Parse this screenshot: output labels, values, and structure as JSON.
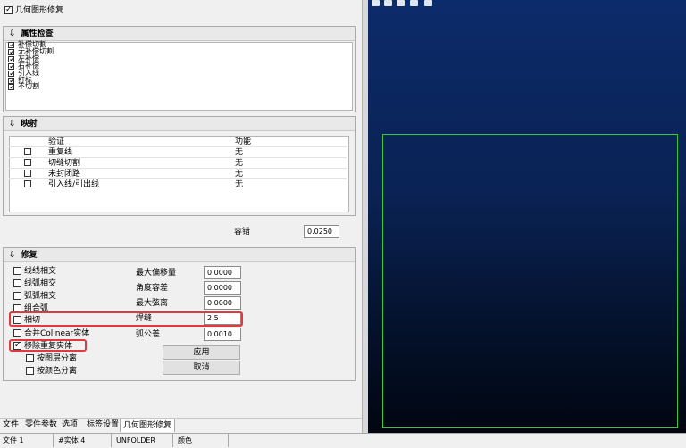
{
  "top_checkbox": {
    "label": "几何图形修复",
    "checked": true
  },
  "attribute_check": {
    "title": "属性检查",
    "items": [
      {
        "label": "补偿切割",
        "checked": true
      },
      {
        "label": "无补偿切割",
        "checked": true
      },
      {
        "label": "左补偿",
        "checked": true
      },
      {
        "label": "右补偿",
        "checked": true
      },
      {
        "label": "引入线",
        "checked": true
      },
      {
        "label": "打标",
        "checked": true
      },
      {
        "label": "不切割",
        "checked": true
      }
    ]
  },
  "mapping": {
    "title": "映射",
    "headers": [
      "验证",
      "功能"
    ],
    "rows": [
      {
        "verify": "重复线",
        "function": "无"
      },
      {
        "verify": "切缝切割",
        "function": "无"
      },
      {
        "verify": "未封闭路",
        "function": "无"
      },
      {
        "verify": "引入线/引出线",
        "function": "无"
      }
    ]
  },
  "tolerance": {
    "label": "容错",
    "value": "0.0250"
  },
  "repair": {
    "title": "修复",
    "options": [
      {
        "label": "线线相交",
        "checked": false
      },
      {
        "label": "线弧相交",
        "checked": false
      },
      {
        "label": "弧弧相交",
        "checked": false
      },
      {
        "label": "组合弧",
        "checked": false
      },
      {
        "label": "相切",
        "checked": false
      },
      {
        "label": "合并Colinear实体",
        "checked": false
      },
      {
        "label": "移除重复实体",
        "checked": true
      },
      {
        "label": "按图层分离",
        "checked": false
      },
      {
        "label": "按颜色分离",
        "checked": false
      }
    ],
    "params": [
      {
        "label": "最大偏移量",
        "value": "0.0000"
      },
      {
        "label": "角度容差",
        "value": "0.0000"
      },
      {
        "label": "最大弦离",
        "value": "0.0000"
      },
      {
        "label": "焊缝",
        "value": "2.5"
      },
      {
        "label": "弧公差",
        "value": "0.0010"
      }
    ],
    "apply_label": "应用",
    "cancel_label": "取消"
  },
  "tabs": [
    "文件",
    "零件参数",
    "选项",
    "标签设置",
    "几何图形修复"
  ],
  "active_tab": "几何图形修复",
  "status_bar": [
    "文件 1",
    "#实体 4",
    "UNFOLDER",
    "颜色"
  ],
  "viewport": {
    "background_top": "#0a2a66",
    "background_bottom": "#020812",
    "rect_color": "#3cc83c"
  }
}
